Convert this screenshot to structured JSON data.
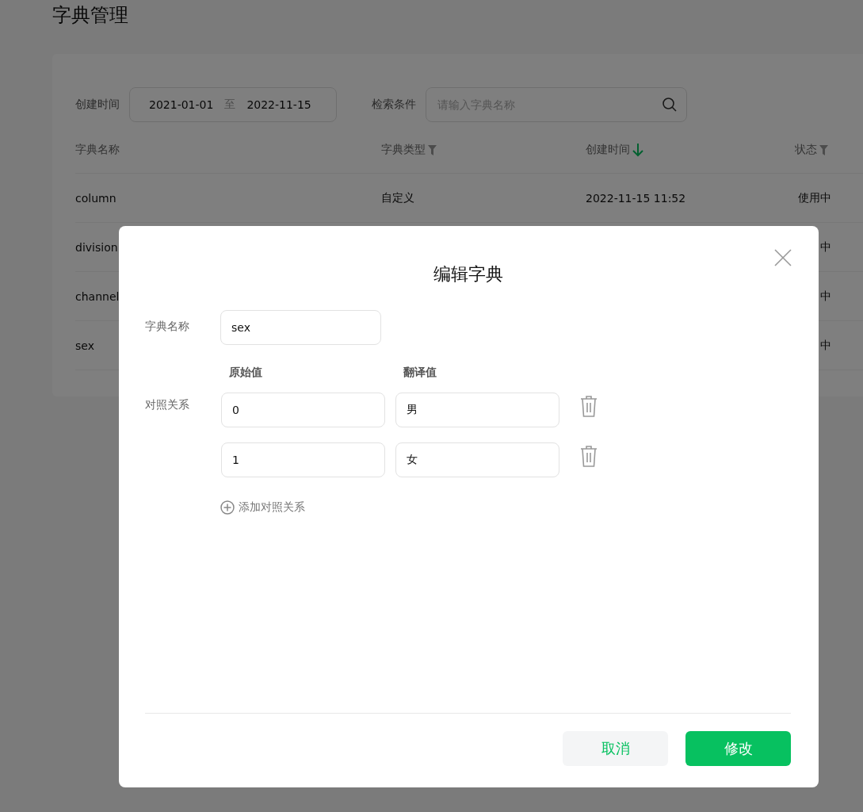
{
  "page": {
    "title": "字典管理"
  },
  "filters": {
    "date_label": "创建时间",
    "date_start": "2021-01-01",
    "date_separator": "至",
    "date_end": "2022-11-15",
    "search_label": "检索条件",
    "search_placeholder": "请输入字典名称"
  },
  "table": {
    "columns": [
      {
        "label": "字典名称",
        "kind": "plain"
      },
      {
        "label": "字典类型",
        "kind": "filter"
      },
      {
        "label": "创建时间",
        "kind": "sort"
      },
      {
        "label": "状态",
        "kind": "filter"
      }
    ],
    "rows": [
      {
        "name": "column",
        "type": "自定义",
        "created": "2022-11-15 11:52",
        "status": "使用中"
      },
      {
        "name": "division",
        "status": "中"
      },
      {
        "name": "channel",
        "status": "中"
      },
      {
        "name": "sex",
        "status": "中"
      }
    ]
  },
  "dialog": {
    "title": "编辑字典",
    "name_label": "字典名称",
    "name_value": "sex",
    "mapping_label": "对照关系",
    "original_header": "原始值",
    "translated_header": "翻译值",
    "mappings": [
      {
        "original": "0",
        "translated": "男"
      },
      {
        "original": "1",
        "translated": "女"
      }
    ],
    "add_label": "添加对照关系",
    "buttons": [
      {
        "label": "取消",
        "kind": "secondary"
      },
      {
        "label": "修改",
        "kind": "primary"
      }
    ]
  }
}
